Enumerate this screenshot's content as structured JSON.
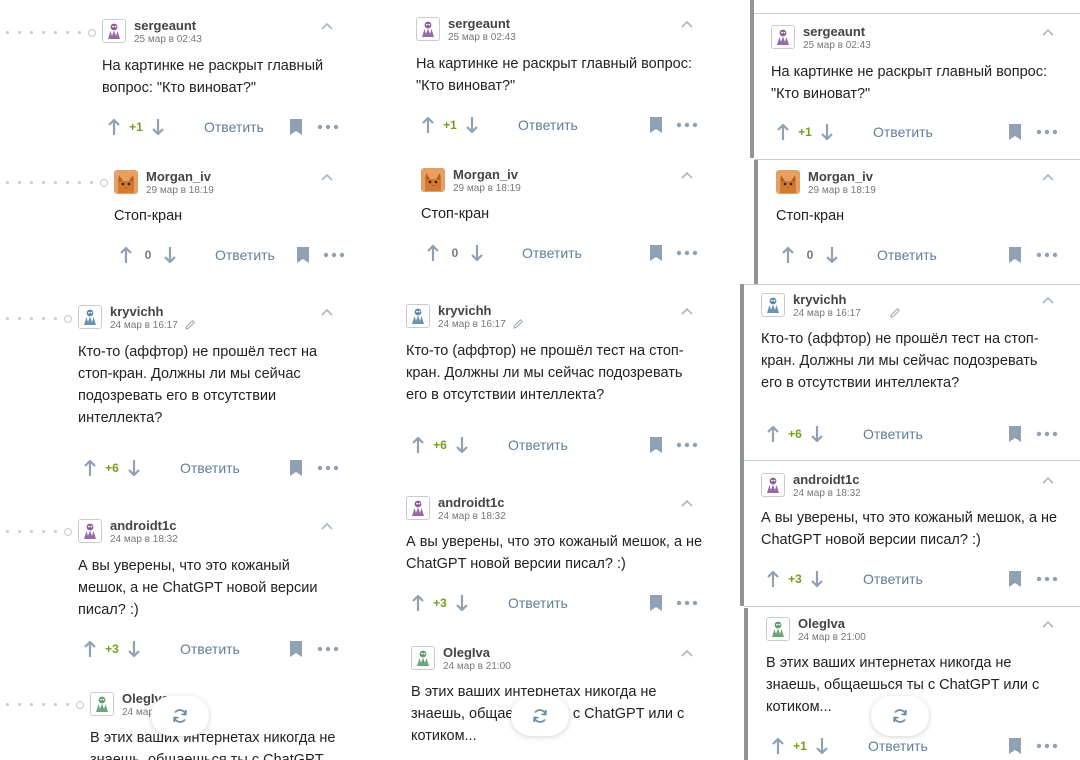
{
  "actions": {
    "reply_label": "Ответить"
  },
  "comments": {
    "sergeaunt": {
      "nick": "sergeaunt",
      "time": "25 мар в 02:43",
      "text": "На картинке не раскрыт главный вопрос: \"Кто виноват?\"",
      "score": "+1"
    },
    "morgan": {
      "nick": "Morgan_iv",
      "time": "29 мар в 18:19",
      "text": "Стоп-кран",
      "score": "0"
    },
    "kryvichh": {
      "nick": "kryvichh",
      "time": "24 мар в 16:17",
      "text": "Кто-то (аффтор) не прошёл тест на стоп-кран. Должны ли мы сейчас подозревать его в отсутствии интеллекта?",
      "score": "+6"
    },
    "androidt": {
      "nick": "androidt1c",
      "time": "24 мар в 18:32",
      "text": "А вы уверены, что это кожаный мешок, а не ChatGPT новой версии писал? :)",
      "score": "+3"
    },
    "olegiva": {
      "nick": "OlegIva",
      "time": "24 мар в 21:00",
      "text": "В этих ваших интернетах никогда не знаешь, общаешься ты с ChatGPT или с котиком...",
      "score": "+1"
    }
  },
  "icons": {
    "avatar": "robot-hand-avatar-icon",
    "cat_avatar": "cat-avatar-icon",
    "upvote": "arrow-up-icon",
    "downvote": "arrow-down-icon",
    "bookmark": "bookmark-icon",
    "more": "more-dots-icon",
    "collapse": "chevron-up-icon",
    "edited": "pencil-icon",
    "refresh": "refresh-icon"
  },
  "colors": {
    "positive_score": "#74a01a",
    "reply_link": "#5f7e98",
    "icon_gray": "#8fa1b3",
    "thread_bar": "#8f9499",
    "avatar_purple": "#8a5a9c",
    "avatar_blue": "#5a86a8",
    "avatar_green": "#5a9c6a"
  }
}
